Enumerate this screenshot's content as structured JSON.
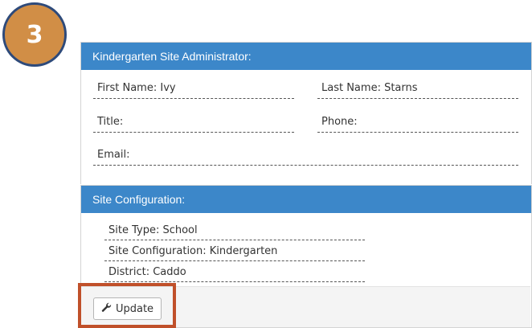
{
  "step": {
    "number": "3"
  },
  "admin_panel": {
    "title": "Kindergarten Site Administrator:",
    "first_name": "First Name: Ivy",
    "last_name": "Last Name: Starns",
    "title_field": "Title:",
    "phone": "Phone:",
    "email": "Email:"
  },
  "config_panel": {
    "title": "Site Configuration:",
    "site_type": "Site Type: School",
    "site_configuration": "Site Configuration: Kindergarten",
    "district": "District: Caddo"
  },
  "actions": {
    "update_label": "Update",
    "update_icon": "wrench-icon"
  },
  "colors": {
    "header_blue": "#3c87c9",
    "badge_orange": "#d18e46",
    "badge_border": "#2e4a7a",
    "highlight_red": "#c0502a"
  }
}
